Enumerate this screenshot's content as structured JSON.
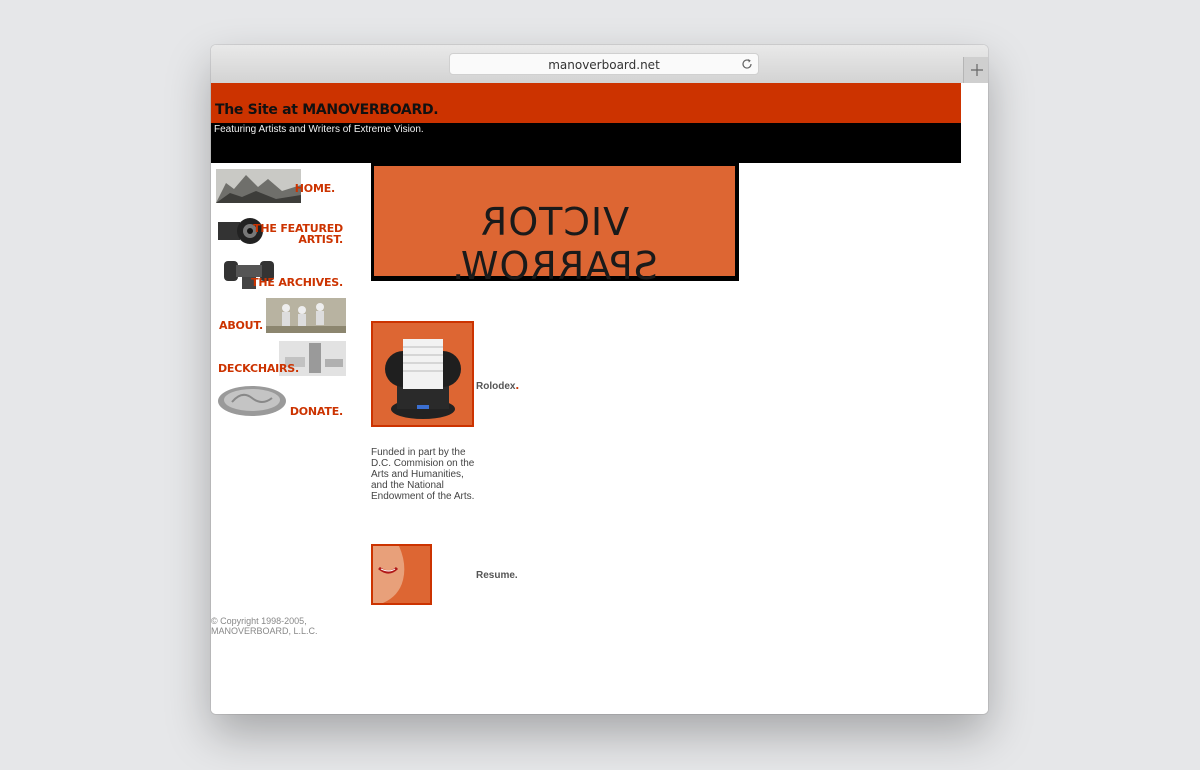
{
  "browser": {
    "url": "manoverboard.net"
  },
  "header": {
    "title": "The Site at MANOVERBOARD.",
    "tagline": "Featuring Artists and Writers of Extreme Vision."
  },
  "nav": {
    "items": [
      {
        "label": "HOME."
      },
      {
        "label_line1": "THE FEATURED",
        "label_line2": "ARTIST."
      },
      {
        "label": "THE ARCHIVES."
      },
      {
        "label": "ABOUT."
      },
      {
        "label": "DECKCHAIRS."
      },
      {
        "label": "DONATE."
      }
    ]
  },
  "banner": {
    "text": "VICTOR SPARROW."
  },
  "main": {
    "rolodex_label": "Rolodex",
    "rolodex_suffix": ".",
    "funding_text": "Funded in part by the D.C. Commision on the Arts and Humanities, and the National Endowment of the Arts.",
    "resume_label": "Resume."
  },
  "footer": {
    "copyright_line1": "© Copyright 1998-2005,",
    "copyright_line2": "MANOVERBOARD, L.L.C."
  },
  "colors": {
    "accent_red": "#cc3300",
    "banner_orange": "#dd6633",
    "background": "#e6e7e9"
  }
}
